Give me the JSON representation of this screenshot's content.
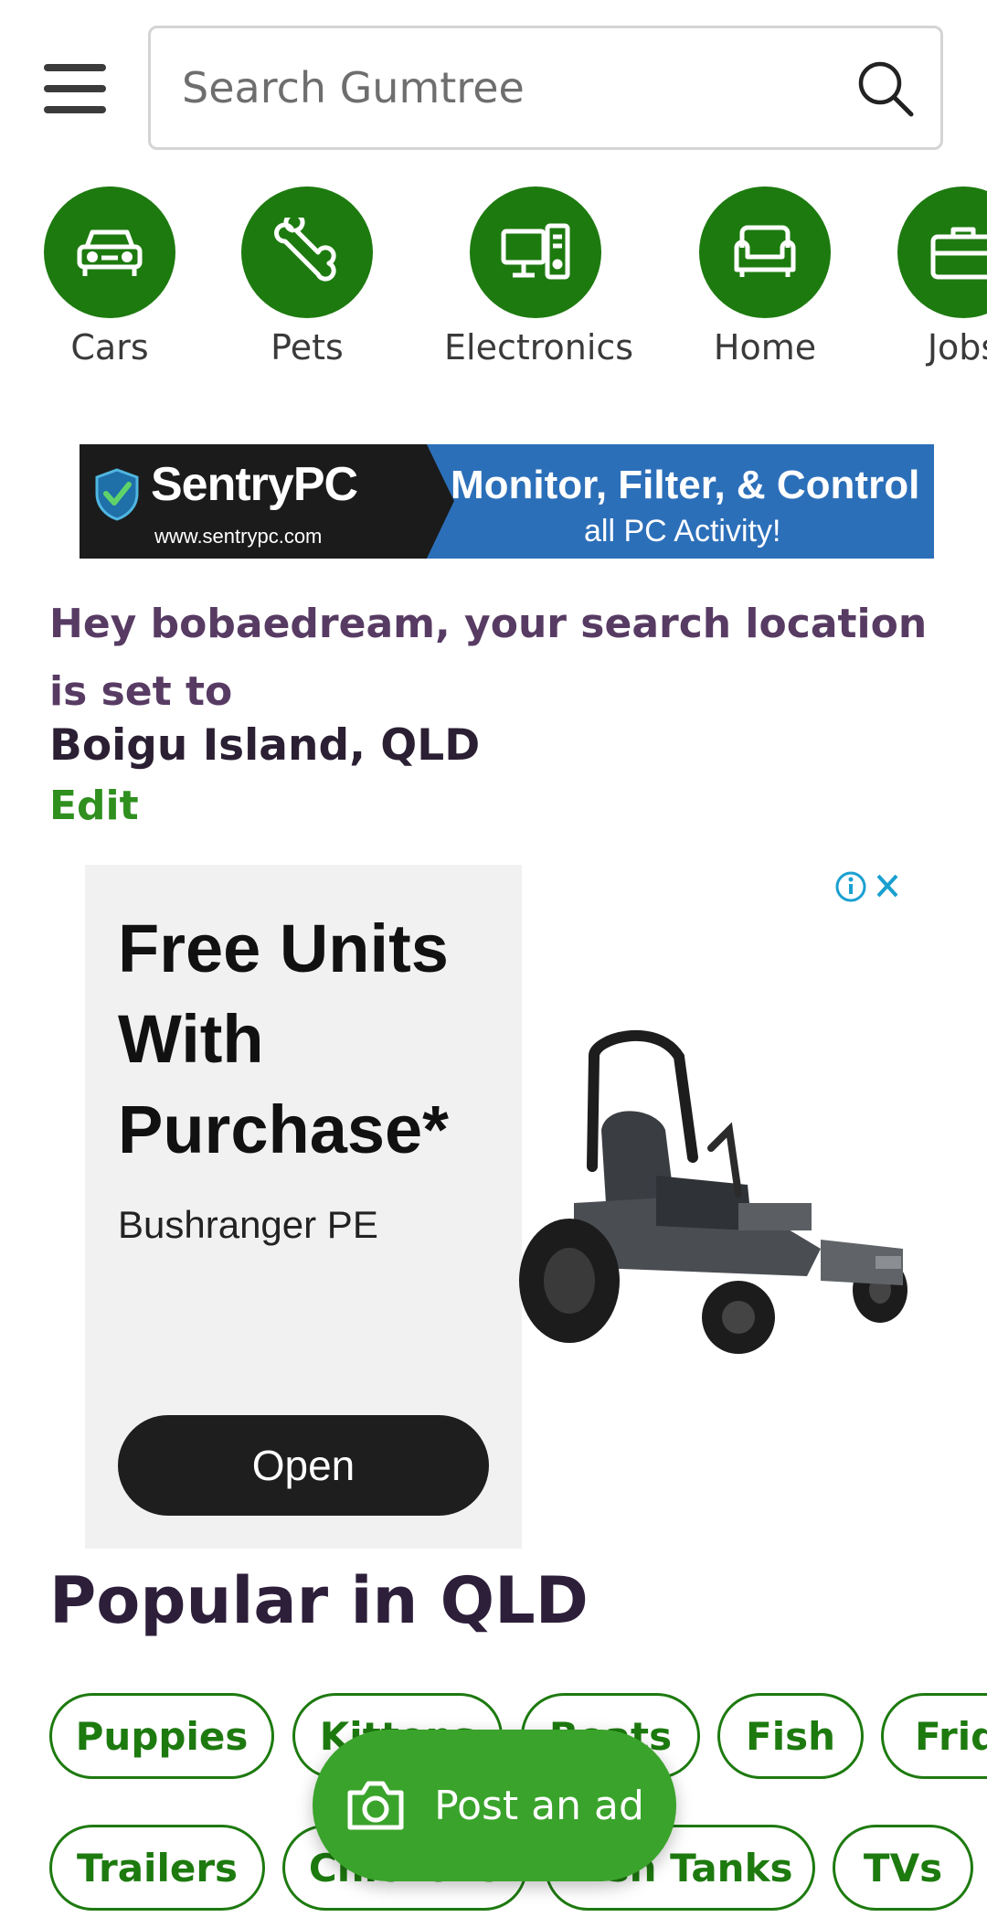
{
  "header": {
    "menu_icon": "hamburger-menu-icon",
    "search_placeholder": "Search Gumtree",
    "search_icon": "search-icon"
  },
  "categories": [
    {
      "label": "Cars",
      "icon": "car-icon"
    },
    {
      "label": "Pets",
      "icon": "bone-icon"
    },
    {
      "label": "Electronics",
      "icon": "computer-icon"
    },
    {
      "label": "Home",
      "icon": "sofa-icon"
    },
    {
      "label": "Jobs",
      "icon": "briefcase-icon"
    }
  ],
  "banner_ad": {
    "brand": "SentryPC",
    "url": "www.sentrypc.com",
    "tagline_1": "Monitor, Filter, & Control",
    "tagline_2": "all PC Activity!"
  },
  "location": {
    "message": "Hey bobaedream, your search location is set to",
    "place": "Boigu Island, QLD",
    "edit_label": "Edit"
  },
  "display_ad": {
    "headline": "Free Units With Purchase*",
    "advertiser": "Bushranger PE",
    "cta": "Open",
    "info_icon": "info-icon",
    "close_icon": "close-icon"
  },
  "popular": {
    "title": "Popular in QLD",
    "row1": [
      "Puppies",
      "Kittens",
      "Boats",
      "Fish",
      "Fridge"
    ],
    "row2": [
      "Trailers",
      "Chickens",
      "Fish Tanks",
      "TVs"
    ]
  },
  "post_ad": {
    "label": "Post an ad",
    "icon": "camera-icon"
  },
  "colors": {
    "brand_green": "#1d7a0f",
    "action_green": "#3aa32b",
    "heading_purple": "#3c2a4d"
  }
}
